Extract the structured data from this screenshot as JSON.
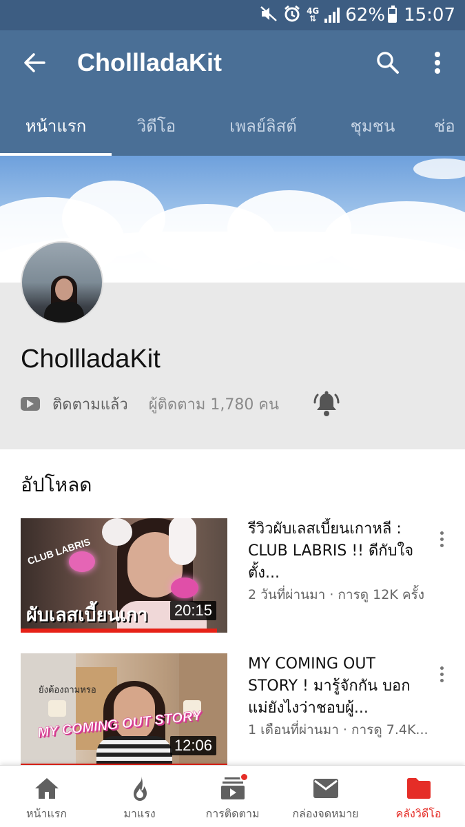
{
  "status_bar": {
    "battery": "62%",
    "battery_level": 0.62,
    "network": "4G",
    "time": "15:07",
    "icons": [
      "mute-vibrate-icon",
      "alarm-icon",
      "network-4g-icon",
      "signal-icon",
      "battery-icon"
    ]
  },
  "app_bar": {
    "title": "ChollladaKit",
    "back_icon": "arrow-back-icon",
    "search_icon": "search-icon",
    "more_icon": "more-vert-icon"
  },
  "tabs": [
    {
      "label": "หน้าแรก",
      "active": true
    },
    {
      "label": "วิดีโอ",
      "active": false
    },
    {
      "label": "เพลย์ลิสต์",
      "active": false
    },
    {
      "label": "ชุมชน",
      "active": false
    },
    {
      "label": "ช่อ",
      "active": false
    }
  ],
  "channel": {
    "name": "ChollladaKit",
    "subscribed_label": "ติดตามแล้ว",
    "subscriber_text": "ผู้ติดตาม 1,780 คน",
    "bell_icon": "bell-ringing-icon"
  },
  "uploads": {
    "title": "อัปโหลด",
    "videos": [
      {
        "title": "รีวิวผับเลสเบี้ยนเกาหลี : CLUB LABRIS !! ดีกับใจตั้ง...",
        "meta": "2 วันที่ผ่านมา · การดู 12K ครั้ง",
        "duration": "20:15",
        "watched_fraction": 0.95,
        "thumb_text_main": "ผับเลสเบี้ยนเกา",
        "thumb_text_small": "CLUB LABRIS"
      },
      {
        "title": "MY COMING OUT STORY ! มารู้จักกัน บอกแม่ยังไงว่าชอบผู้...",
        "meta": "1 เดือนที่ผ่านมา · การดู 7.4K...",
        "duration": "12:06",
        "watched_fraction": 1.0,
        "thumb_text_main": "MY COMING OUT STORY",
        "thumb_text_small": "ยังต้องถามหรอ"
      }
    ]
  },
  "bottom_nav": [
    {
      "label": "หน้าแรก",
      "icon": "home-icon",
      "active": false
    },
    {
      "label": "มาแรง",
      "icon": "trending-flame-icon",
      "active": false
    },
    {
      "label": "การติดตาม",
      "icon": "subscriptions-icon",
      "active": false,
      "notification_dot": true
    },
    {
      "label": "กล่องจดหมาย",
      "icon": "inbox-mail-icon",
      "active": false
    },
    {
      "label": "คลังวิดีโอ",
      "icon": "library-folder-icon",
      "active": true
    }
  ],
  "colors": {
    "status_bar": "#3d5d82",
    "app_bar": "#4a6f96",
    "header_bg": "#e9e9e9",
    "accent_red": "#e52d27"
  }
}
